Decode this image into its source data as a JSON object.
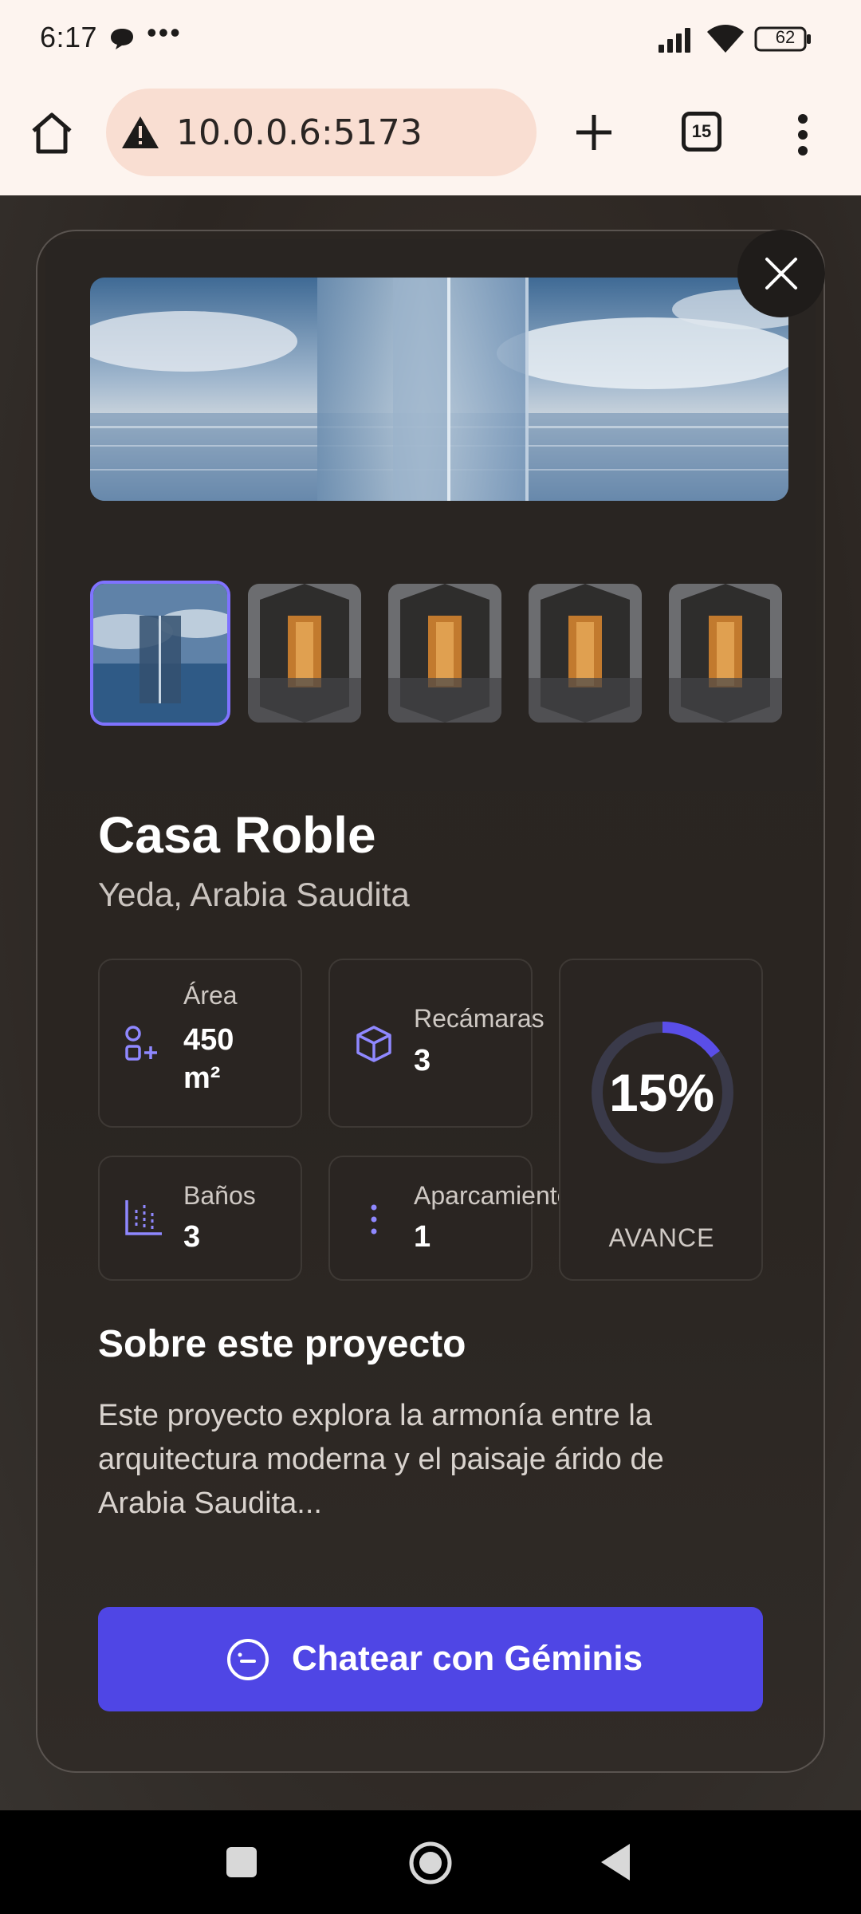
{
  "status_bar": {
    "time": "6:17",
    "dots": "•••",
    "battery": "62"
  },
  "browser": {
    "url": "10.0.0.6:5173",
    "tab_count": "15"
  },
  "project": {
    "title": "Casa Roble",
    "location": "Yeda, Arabia Saudita",
    "stats": [
      {
        "label": "Área",
        "value": "450\nm²",
        "icon": "area-icon"
      },
      {
        "label": "Recámaras",
        "value": "3",
        "icon": "cube-icon"
      },
      {
        "label": "Baños",
        "value": "3",
        "icon": "bath-icon"
      },
      {
        "label": "Aparcamiento",
        "value": "1",
        "icon": "parking-icon"
      }
    ],
    "progress": {
      "percent_text": "15%",
      "value": 0.15,
      "label": "AVANCE"
    },
    "about_title": "Sobre este proyecto",
    "about_text": "Este proyecto explora la armonía entre la arquitectura moderna y el paisaje árido de Arabia Saudita...",
    "chat_button": "Chatear con Géminis"
  },
  "colors": {
    "accent": "#4f46e5",
    "ring_active": "#5a4ee8",
    "thumb_border": "#7f73ff"
  }
}
